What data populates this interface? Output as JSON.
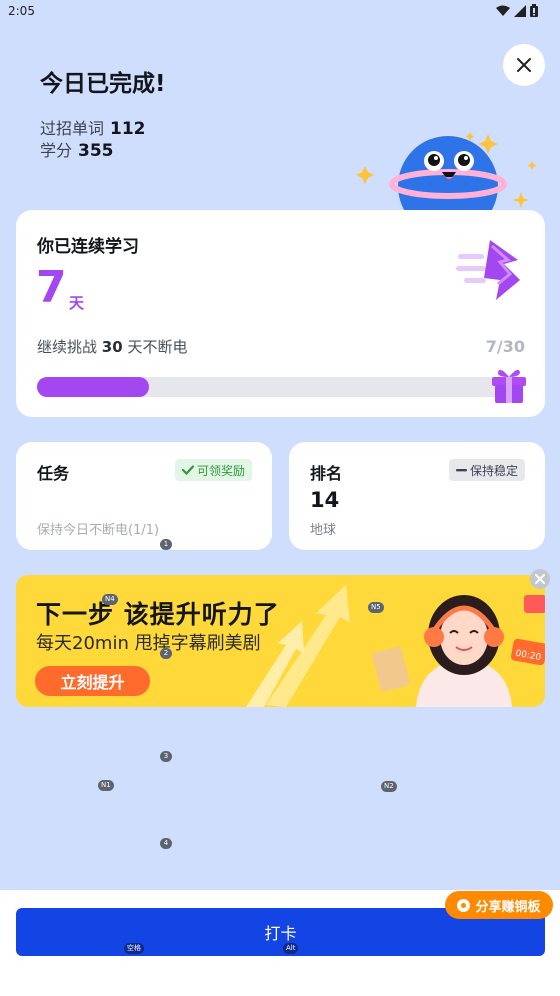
{
  "status_bar": {
    "time": "2:05",
    "icons": [
      "wifi-icon",
      "signal-icon",
      "battery-icon"
    ]
  },
  "header": {
    "title": "今日已完成!",
    "words_label": "过招单词",
    "words_value": "112",
    "score_label": "学分",
    "score_value": "355"
  },
  "streak": {
    "title": "你已连续学习",
    "days": "7",
    "unit": "天",
    "goal_prefix": "继续挑战",
    "goal_days": "30",
    "goal_suffix": "天不断电",
    "progress_text": "7/30",
    "progress_fraction": 0.233
  },
  "task_card": {
    "title": "任务",
    "badge": "可领奖励",
    "subtitle": "保持今日不断电(1/1)"
  },
  "rank_card": {
    "title": "排名",
    "badge": "保持稳定",
    "value": "14",
    "subtitle": "地球"
  },
  "banner": {
    "title": "下一步 该提升听力了",
    "subtitle": "每天20min 甩掉字幕刷美剧",
    "cta": "立刻提升",
    "clock_text": "00:20"
  },
  "hints": [
    "1",
    "2",
    "3",
    "4",
    "N1",
    "N2",
    "N4",
    "N5",
    "空格",
    "Alt"
  ],
  "bottom": {
    "checkin_label": "打卡",
    "share_label": "分享赚铜板"
  },
  "colors": {
    "background": "#cfdefc",
    "accent_purple": "#a347f0",
    "primary_blue": "#1245e3",
    "banner_yellow": "#ffd93a",
    "cta_orange": "#ff6a2d",
    "share_orange": "#ff8a00"
  }
}
